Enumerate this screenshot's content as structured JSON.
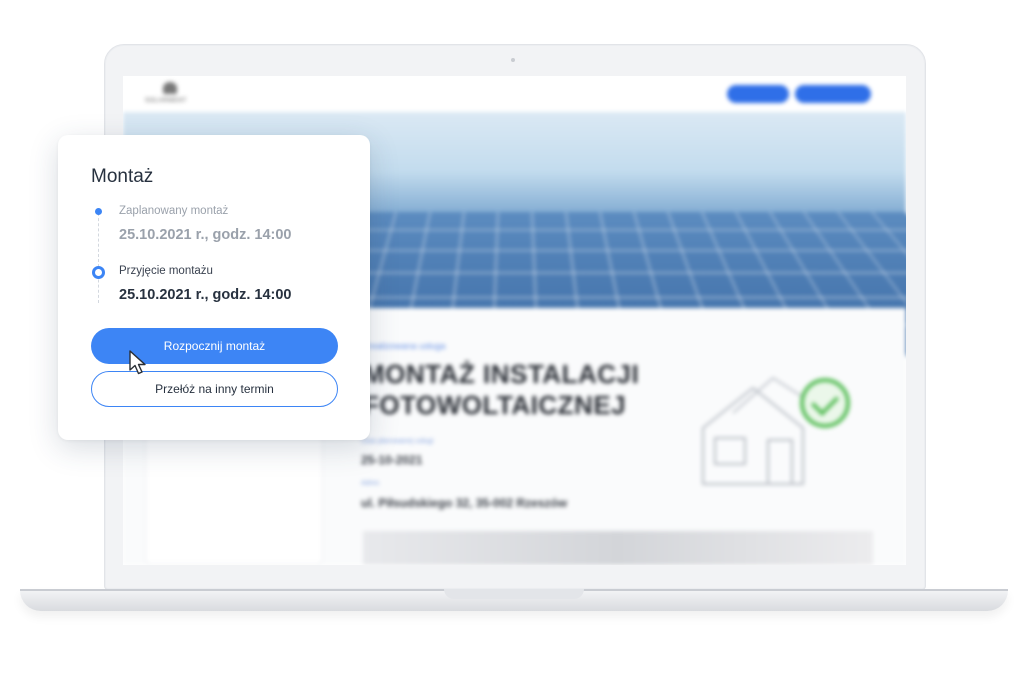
{
  "popup": {
    "title": "Montaż",
    "steps": [
      {
        "label": "Zaplanowany montaż",
        "date": "25.10.2021 r., godz. 14:00",
        "status": "done"
      },
      {
        "label": "Przyjęcie montażu",
        "date": "25.10.2021 r., godz. 14:00",
        "status": "current"
      }
    ],
    "primary_button": "Rozpocznij montaż",
    "secondary_button": "Przełóż na inny termin"
  },
  "background_page": {
    "title": "MONTAŻ INSTALACJI FOTOWOLTAICZNEJ",
    "date_value": "25-10-2021",
    "address_value": "ul. Piłsudskiego 32, 35-002 Rzeszów"
  },
  "colors": {
    "accent": "#3d85f5",
    "text_dark": "#27313f",
    "text_muted": "#9aa1ab",
    "success": "#5bbf5b"
  }
}
